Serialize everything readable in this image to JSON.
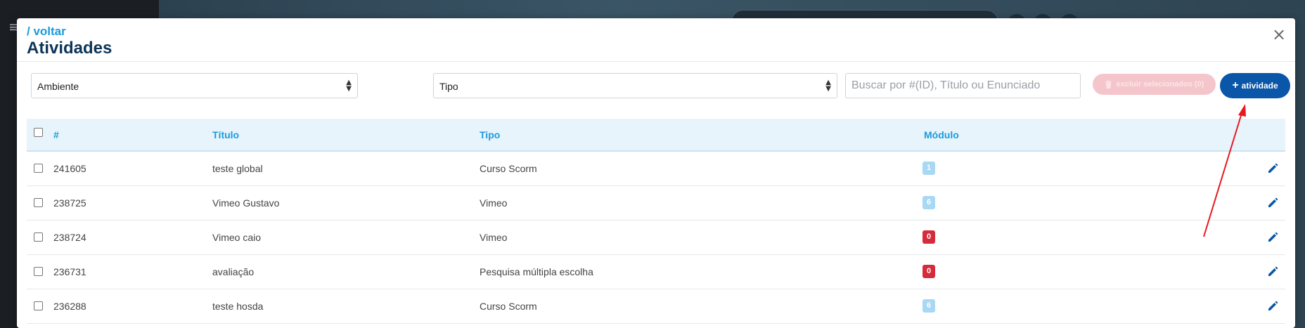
{
  "header": {
    "back_label": "/ voltar",
    "title": "Atividades",
    "close_glyph": "×"
  },
  "filters": {
    "ambiente_select": "Ambiente",
    "tipo_select": "Tipo",
    "search_placeholder": "Buscar por #(ID), Título ou Enunciado",
    "delete_button": "excluir selecionados (0)",
    "add_button": "atividade"
  },
  "table": {
    "columns": [
      "#",
      "Título",
      "Tipo",
      "Módulo"
    ],
    "rows": [
      {
        "id": "241605",
        "titulo": "teste global",
        "tipo": "Curso Scorm",
        "modulo": "1",
        "modulo_color": "blue"
      },
      {
        "id": "238725",
        "titulo": "Vimeo Gustavo",
        "tipo": "Vimeo",
        "modulo": "6",
        "modulo_color": "blue"
      },
      {
        "id": "238724",
        "titulo": "Vimeo caio",
        "tipo": "Vimeo",
        "modulo": "0",
        "modulo_color": "red"
      },
      {
        "id": "236731",
        "titulo": "avaliação",
        "tipo": "Pesquisa múltipla escolha",
        "modulo": "0",
        "modulo_color": "red"
      },
      {
        "id": "236288",
        "titulo": "teste hosda",
        "tipo": "Curso Scorm",
        "modulo": "6",
        "modulo_color": "blue"
      }
    ]
  },
  "colors": {
    "accent": "#1a9bdc",
    "primary_button": "#0a56a8",
    "title": "#0d3558",
    "badge_blue": "#a8d8f4",
    "badge_red": "#d42c3c",
    "annotation_arrow": "#e8181e"
  },
  "icons": {
    "edit": "pencil-icon",
    "delete": "trash-icon",
    "close": "close-icon",
    "add": "plus-icon"
  }
}
